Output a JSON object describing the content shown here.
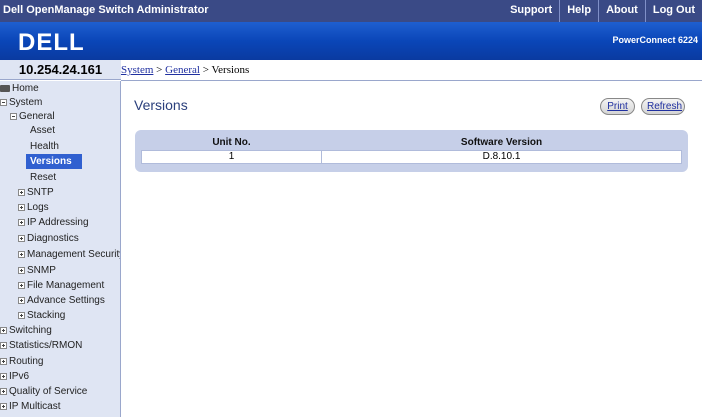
{
  "header": {
    "app_title": "Dell OpenManage Switch Administrator",
    "links": [
      "Support",
      "Help",
      "About",
      "Log Out"
    ]
  },
  "banner": {
    "logo_text": "DELL",
    "product": "PowerConnect 6224"
  },
  "ip_address": "10.254.24.161",
  "breadcrumb": {
    "items": [
      "System",
      "General",
      "Versions"
    ],
    "separator": " > "
  },
  "sidebar": {
    "items": [
      {
        "label": "Home",
        "icon": "folder-icon"
      },
      {
        "label": "System",
        "expander": "minus"
      },
      {
        "label": "General",
        "expander": "minus"
      },
      {
        "label": "Asset"
      },
      {
        "label": "Health"
      },
      {
        "label": "Versions",
        "selected": true
      },
      {
        "label": "Reset"
      },
      {
        "label": "SNTP",
        "expander": "plus"
      },
      {
        "label": "Logs",
        "expander": "plus"
      },
      {
        "label": "IP Addressing",
        "expander": "plus"
      },
      {
        "label": "Diagnostics",
        "expander": "plus"
      },
      {
        "label": "Management Security",
        "expander": "plus"
      },
      {
        "label": "SNMP",
        "expander": "plus"
      },
      {
        "label": "File Management",
        "expander": "plus"
      },
      {
        "label": "Advance Settings",
        "expander": "plus"
      },
      {
        "label": "Stacking",
        "expander": "plus"
      },
      {
        "label": "Switching",
        "expander": "plus"
      },
      {
        "label": "Statistics/RMON",
        "expander": "plus"
      },
      {
        "label": "Routing",
        "expander": "plus"
      },
      {
        "label": "IPv6",
        "expander": "plus"
      },
      {
        "label": "Quality of Service",
        "expander": "plus"
      },
      {
        "label": "IP Multicast",
        "expander": "plus"
      }
    ]
  },
  "main": {
    "title": "Versions",
    "buttons": {
      "print": "Print",
      "refresh": "Refresh"
    },
    "table": {
      "headers": [
        "Unit No.",
        "Software Version"
      ],
      "rows": [
        [
          "1",
          "D.8.10.1"
        ]
      ]
    }
  },
  "colors": {
    "topbar": "#3a4a86",
    "banner": "#0a46b8",
    "sidebar_bg": "#dfe5f3",
    "selected": "#3060d0",
    "table_frame": "#c6cfe8"
  }
}
